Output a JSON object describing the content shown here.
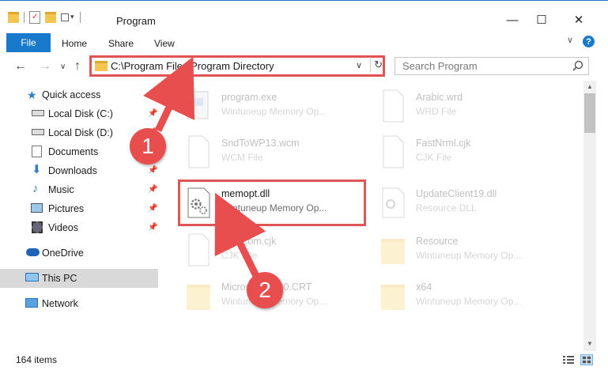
{
  "window": {
    "title": "Program",
    "minimize_glyph": "—",
    "maximize_glyph": "☐",
    "close_glyph": "✕"
  },
  "ribbon": {
    "tabs": [
      "File",
      "Home",
      "Share",
      "View"
    ],
    "expand_glyph": "∨",
    "help_glyph": "?"
  },
  "address": {
    "path": "C:\\Program Files\\Program Directory",
    "dropdown_glyph": "∨",
    "refresh_glyph": "↻"
  },
  "search": {
    "placeholder": "Search Program"
  },
  "nav": {
    "back_glyph": "←",
    "forward_glyph": "→",
    "recent_glyph": "∨",
    "up_glyph": "↑",
    "pin_glyph": "📌",
    "items": [
      {
        "label": "Quick access",
        "icon": "star-icon"
      },
      {
        "label": "Local Disk (C:)",
        "icon": "drive-icon",
        "pinned": true
      },
      {
        "label": "Local Disk (D:)",
        "icon": "drive-icon",
        "pinned": true
      },
      {
        "label": "Documents",
        "icon": "documents-icon",
        "pinned": true
      },
      {
        "label": "Downloads",
        "icon": "downloads-icon",
        "pinned": true
      },
      {
        "label": "Music",
        "icon": "music-icon",
        "pinned": true
      },
      {
        "label": "Pictures",
        "icon": "pictures-icon",
        "pinned": true
      },
      {
        "label": "Videos",
        "icon": "videos-icon",
        "pinned": true
      },
      {
        "label": "OneDrive",
        "icon": "onedrive-icon"
      },
      {
        "label": "This PC",
        "icon": "this-pc-icon",
        "selected": true
      },
      {
        "label": "Network",
        "icon": "network-icon"
      }
    ]
  },
  "files": [
    {
      "name": "program.exe",
      "type": "Wintuneup Memory Op...",
      "icon": "exe-icon",
      "faded": true
    },
    {
      "name": "Arabic.wrd",
      "type": "WRD File",
      "icon": "blank-file-icon",
      "faded": true
    },
    {
      "name": "SndToWP13.wcm",
      "type": "WCM File",
      "icon": "blank-file-icon",
      "faded": true
    },
    {
      "name": "FastNrml.cjk",
      "type": "CJK File",
      "icon": "blank-file-icon",
      "faded": true
    },
    {
      "name": "memopt.dll",
      "type": "Wintuneup Memory Op...",
      "icon": "dll-icon",
      "faded": false
    },
    {
      "name": "UpdateClient19.dll",
      "type": "Resource DLL",
      "icon": "dll-icon",
      "faded": true
    },
    {
      "name": "FastCom.cjk",
      "type": "CJK File",
      "icon": "blank-file-icon",
      "faded": true
    },
    {
      "name": "Resource",
      "type": "Wintuneup Memory Op...",
      "icon": "folder-icon",
      "faded": true
    },
    {
      "name": "Microsoft.VC90.CRT",
      "type": "Wintuneup Memory Op...",
      "icon": "folder-icon",
      "faded": true
    },
    {
      "name": "x64",
      "type": "Wintuneup Memory Op...",
      "icon": "folder-icon",
      "faded": true
    }
  ],
  "annotations": [
    "1",
    "2"
  ],
  "status": {
    "item_count": "164 items"
  },
  "colors": {
    "accent": "#1979ca",
    "annotation": "#e84e4e",
    "selection": "#d9d9d9"
  }
}
